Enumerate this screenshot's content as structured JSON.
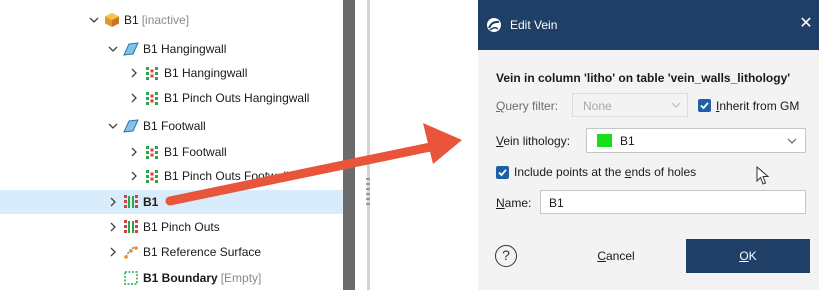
{
  "tree": {
    "items": [
      {
        "label": "B1",
        "suffix": "[inactive]",
        "icon": "geological-model-icon",
        "expand": "expanded"
      },
      {
        "label": "B1 Hangingwall",
        "suffix": "",
        "icon": "surface-icon",
        "expand": "expanded"
      },
      {
        "label": "B1 Hangingwall",
        "suffix": "",
        "icon": "points-icon",
        "expand": "collapsed"
      },
      {
        "label": "B1 Pinch Outs Hangingwall",
        "suffix": "",
        "icon": "points-icon",
        "expand": "collapsed"
      },
      {
        "label": "B1 Footwall",
        "suffix": "",
        "icon": "surface-icon",
        "expand": "expanded"
      },
      {
        "label": "B1 Footwall",
        "suffix": "",
        "icon": "points-icon",
        "expand": "collapsed"
      },
      {
        "label": "B1 Pinch Outs Footwall",
        "suffix": "",
        "icon": "points-icon",
        "expand": "collapsed"
      },
      {
        "label": "B1",
        "suffix": "",
        "icon": "vein-points-icon",
        "expand": "collapsed"
      },
      {
        "label": "B1 Pinch Outs",
        "suffix": "",
        "icon": "vein-points-icon",
        "expand": "collapsed"
      },
      {
        "label": "B1 Reference Surface",
        "suffix": "",
        "icon": "reference-surface-icon",
        "expand": "collapsed"
      },
      {
        "label": "B1 Boundary",
        "suffix": "[Empty]",
        "icon": "boundary-icon",
        "expand": "none"
      }
    ],
    "selected_index": 7
  },
  "dialog": {
    "title": "Edit Vein",
    "close_glyph": "✕",
    "heading": "Vein in column 'litho' on table 'vein_walls_lithology'",
    "query_filter_label": "Query filter:",
    "query_filter_value": "None",
    "inherit_label": "Inherit from GM",
    "vein_lithology_label": "Vein lithology:",
    "vein_lithology_value": "B1",
    "vein_lithology_color": "#18e018",
    "include_points_label": "Include points at the ends of holes",
    "name_label": "Name:",
    "name_value": "B1",
    "help_glyph": "?",
    "cancel_label": "Cancel",
    "ok_label": "OK"
  },
  "colors": {
    "titlebar": "#1f3f66",
    "selection": "#d9ecfb",
    "arrow": "#e8553a",
    "checkbox": "#1f5fa6"
  }
}
